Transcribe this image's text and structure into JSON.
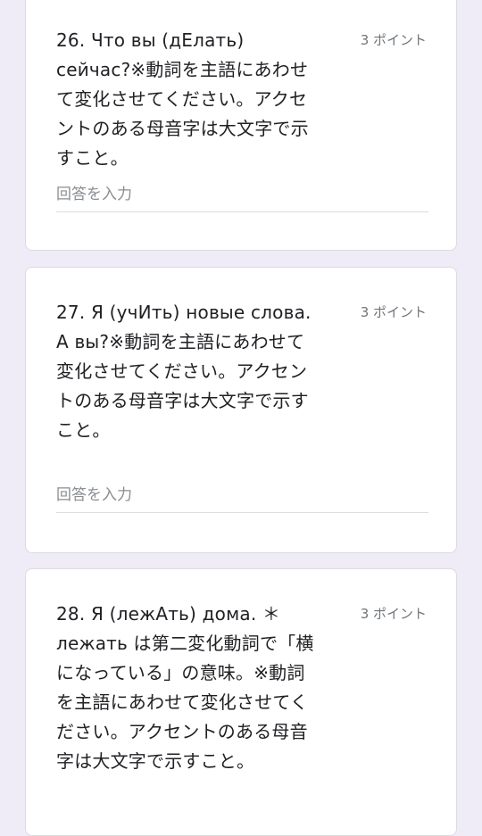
{
  "questions": [
    {
      "title": "26. Что вы (дЕлать) сейчас?※動詞を主語にあわせて変化させてください。アクセントのある母音字は大文字で示すこと。",
      "points": "3 ポイント",
      "answer_placeholder": "回答を入力",
      "answer_value": ""
    },
    {
      "title": "27. Я (учИть) новые слова. А вы?※動詞を主語にあわせて変化させてください。アクセントのある母音字は大文字で示すこと。",
      "points": "3 ポイント",
      "answer_placeholder": "回答を入力",
      "answer_value": ""
    },
    {
      "title": "28. Я (лежАть) дома. ＊лежать は第二変化動詞で「横になっている」の意味。※動詞を主語にあわせて変化させてください。アクセントのある母音字は大文字で示すこと。",
      "points": "3 ポイント"
    }
  ]
}
